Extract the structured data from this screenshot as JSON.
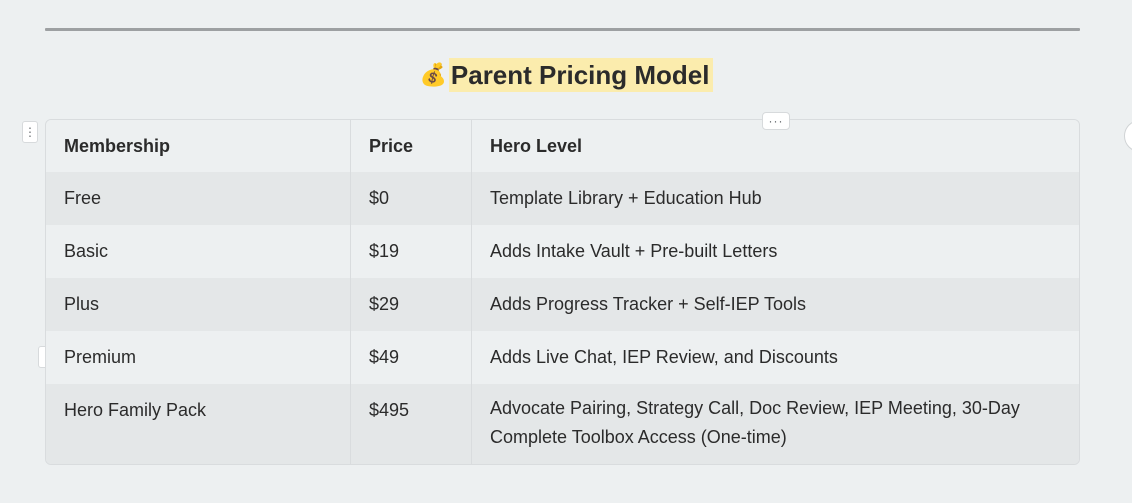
{
  "title": {
    "icon": "money-bag-icon",
    "emoji": "💰",
    "text": "Parent Pricing Model"
  },
  "table": {
    "headers": [
      "Membership",
      "Price",
      "Hero Level"
    ],
    "rows": [
      {
        "membership": "Free",
        "price": "$0",
        "hero_level": "Template Library + Education Hub"
      },
      {
        "membership": "Basic",
        "price": "$19",
        "hero_level": "Adds Intake Vault + Pre-built Letters"
      },
      {
        "membership": "Plus",
        "price": "$29",
        "hero_level": "Adds Progress Tracker + Self-IEP Tools"
      },
      {
        "membership": "Premium",
        "price": "$49",
        "hero_level": "Adds Live Chat, IEP Review, and Discounts"
      },
      {
        "membership": "Hero Family Pack",
        "price": "$495",
        "hero_level": "Advocate Pairing, Strategy Call, Doc Review, IEP Meeting, 30-Day Complete Toolbox Access (One-time)"
      }
    ]
  },
  "controls": {
    "more_glyph": "···",
    "drag_glyph": "⋮"
  },
  "colors": {
    "page_background": "#edf0f1",
    "title_highlight": "#fbecad",
    "striped_row": "#e4e7e8"
  }
}
